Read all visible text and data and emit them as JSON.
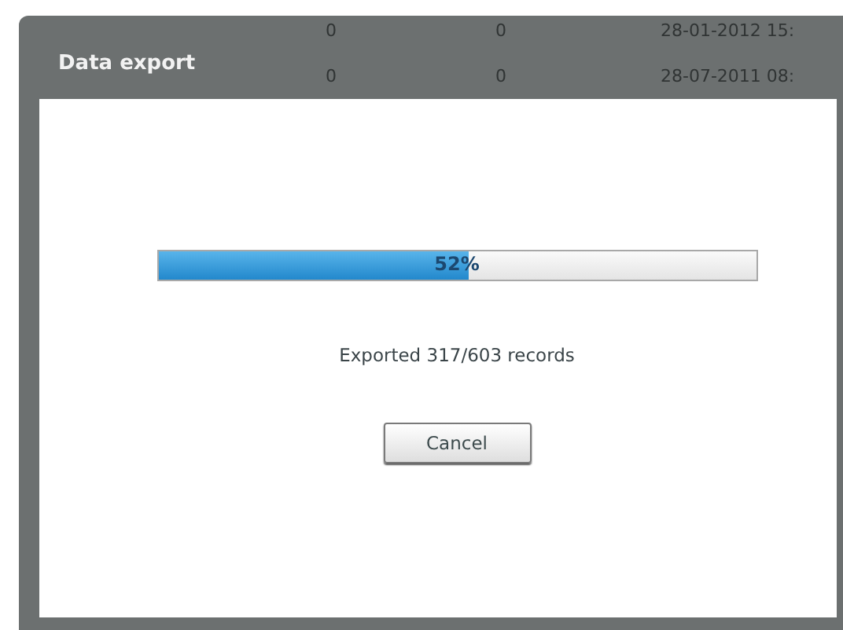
{
  "background_table": {
    "rows": [
      {
        "cells": [
          "0",
          "0",
          "28-01-2012 15:"
        ]
      },
      {
        "cells": [
          "0",
          "0",
          "28-07-2011 08:"
        ]
      }
    ]
  },
  "dialog": {
    "title": "Data export",
    "progress": {
      "level": 0.52,
      "label": "52%"
    },
    "status": "Exported 317/603 records",
    "buttons": [
      "Cancel"
    ]
  }
}
